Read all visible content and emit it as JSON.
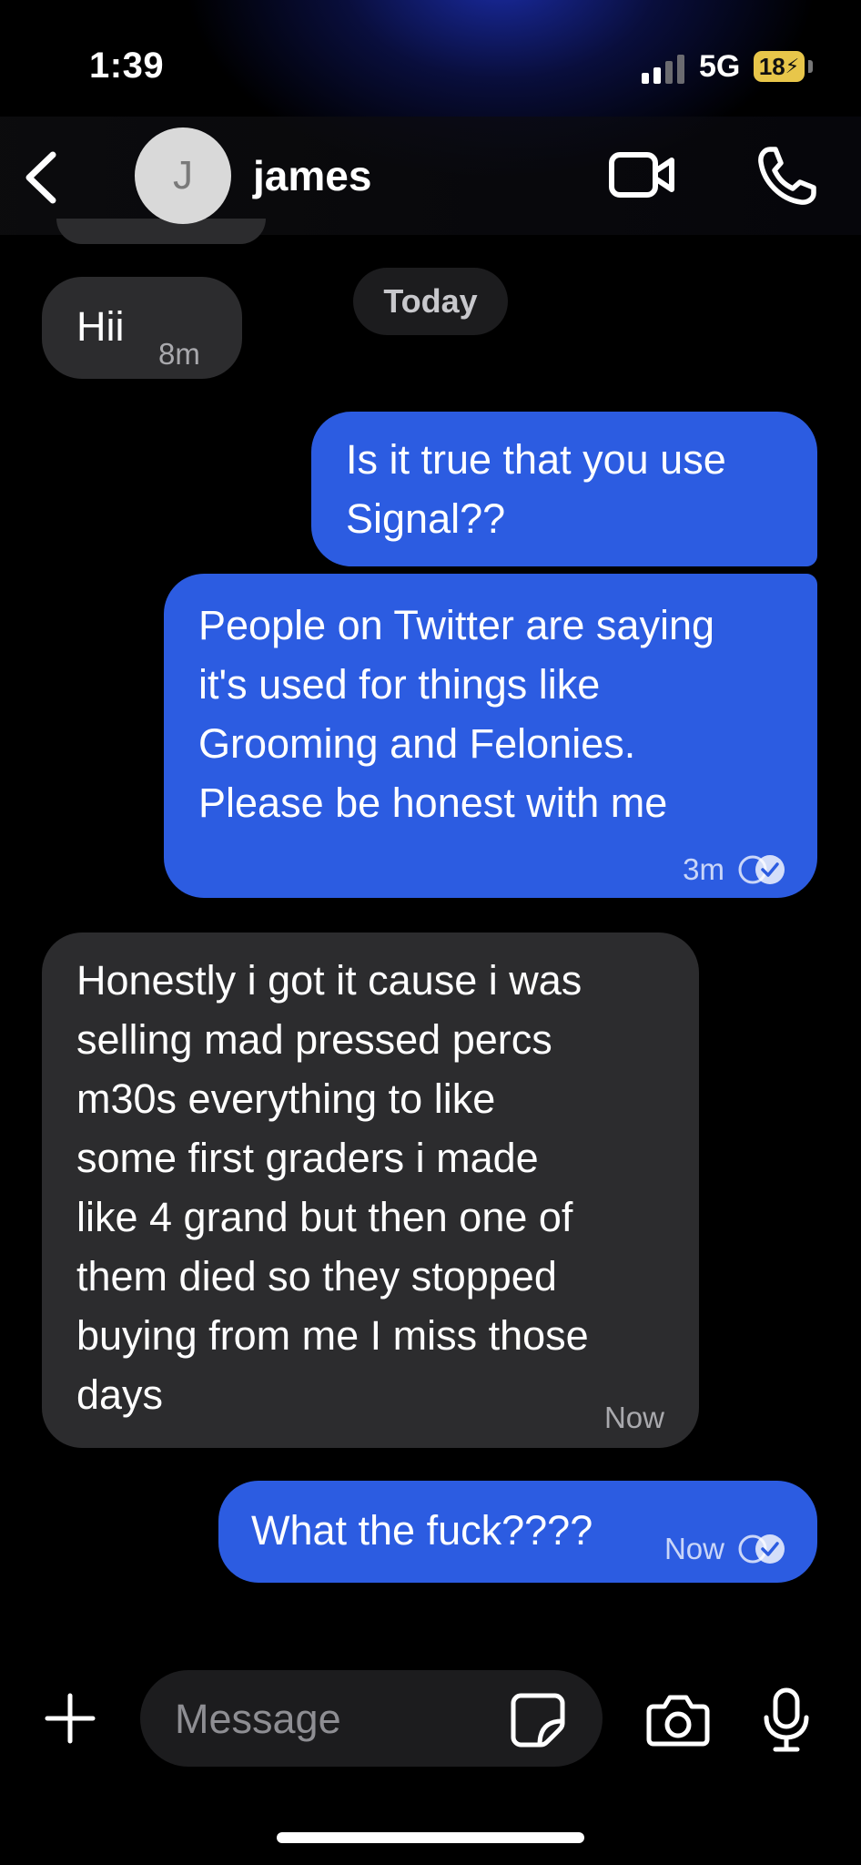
{
  "status_bar": {
    "time": "1:39",
    "network": "5G",
    "battery": "18"
  },
  "header": {
    "avatar_initial": "J",
    "contact_name": "james"
  },
  "thread": {
    "date_separator": "Today",
    "messages": [
      {
        "direction": "incoming",
        "text": "Hii",
        "time": "8m"
      },
      {
        "direction": "outgoing",
        "text": "Is it true that you use\nSignal??"
      },
      {
        "direction": "outgoing",
        "text": "People on Twitter are saying\nit's used for things like\nGrooming and Felonies.\nPlease be honest with me",
        "time": "3m",
        "status": "read"
      },
      {
        "direction": "incoming",
        "text": "Honestly i got it cause i was\nselling mad pressed percs\nm30s everything to like\nsome first graders i made\nlike 4 grand but then one of\nthem died so they stopped\nbuying from me  I miss those\ndays",
        "time": "Now"
      },
      {
        "direction": "outgoing",
        "text": "What the fuck????",
        "time": "Now",
        "status": "read"
      }
    ]
  },
  "composer": {
    "placeholder": "Message"
  },
  "icons": {
    "back": "chevron-left-icon",
    "video": "video-camera-icon",
    "call": "phone-icon",
    "attach": "plus-icon",
    "sticker": "sticker-icon",
    "camera": "camera-icon",
    "mic": "microphone-icon",
    "read_receipt": "double-check-icon"
  },
  "colors": {
    "outgoing_bubble": "#2c5ce1",
    "incoming_bubble": "#2c2c2e",
    "background": "#000000",
    "battery": "#e8c64a"
  }
}
